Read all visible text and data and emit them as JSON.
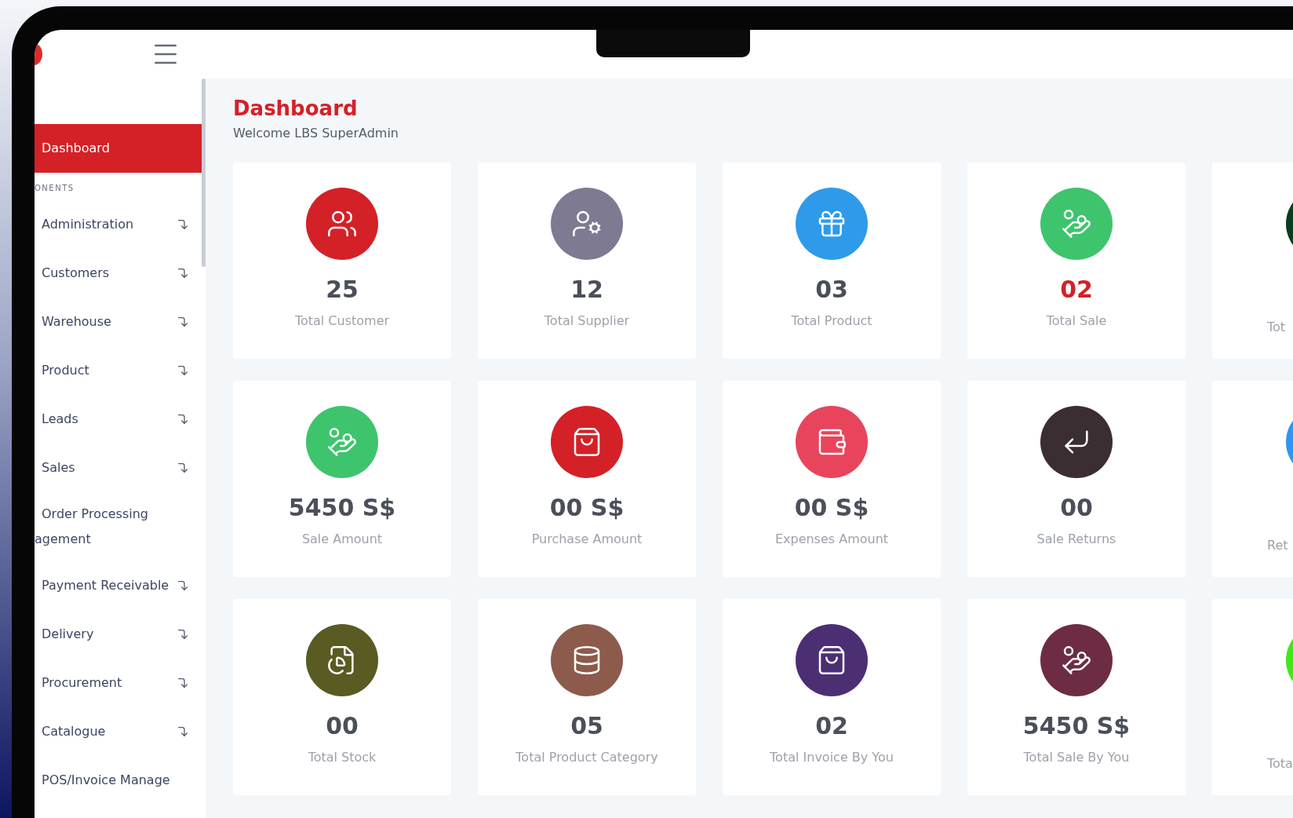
{
  "sidebar": {
    "items": [
      {
        "label": "Dashboard",
        "kind": "plain",
        "selected": true
      },
      {
        "label": "ONENTS",
        "kind": "heading"
      },
      {
        "label": "Administration",
        "kind": "expandable",
        "selected": false
      },
      {
        "label": "Customers",
        "kind": "expandable",
        "selected": false
      },
      {
        "label": "Warehouse",
        "kind": "expandable",
        "selected": false
      },
      {
        "label": "Product",
        "kind": "expandable",
        "selected": false
      },
      {
        "label": "Leads",
        "kind": "expandable",
        "selected": false
      },
      {
        "label": "Sales",
        "kind": "expandable",
        "selected": false
      },
      {
        "label": "Order Processing",
        "continued": "agement",
        "kind": "plain",
        "selected": false
      },
      {
        "label": "Payment Receivable",
        "kind": "expandable",
        "selected": false
      },
      {
        "label": "Delivery",
        "kind": "expandable",
        "selected": false
      },
      {
        "label": "Procurement",
        "kind": "expandable",
        "selected": false
      },
      {
        "label": "Catalogue",
        "kind": "expandable",
        "selected": false
      },
      {
        "label": "POS/Invoice Manage",
        "kind": "plain",
        "selected": false
      }
    ]
  },
  "header": {
    "title": "Dashboard",
    "subtitle": "Welcome LBS SuperAdmin"
  },
  "cards": [
    {
      "kind": "full",
      "value": "25",
      "label": "Total Customer",
      "color": "#d42127",
      "emphasis": false
    },
    {
      "kind": "full",
      "value": "12",
      "label": "Total Supplier",
      "color": "#7e7a92",
      "emphasis": false
    },
    {
      "kind": "full",
      "value": "03",
      "label": "Total Product",
      "color": "#2e9bea",
      "emphasis": false
    },
    {
      "kind": "full",
      "value": "02",
      "label": "Total Sale",
      "color": "#3ec46d",
      "emphasis": true
    },
    {
      "kind": "partial",
      "label": "Tot",
      "color": "#0a3d1e"
    },
    {
      "kind": "full",
      "value": "5450 S$",
      "label": "Sale Amount",
      "color": "#3ec46d",
      "emphasis": false
    },
    {
      "kind": "full",
      "value": "00 S$",
      "label": "Purchase Amount",
      "color": "#d42127",
      "emphasis": false
    },
    {
      "kind": "full",
      "value": "00 S$",
      "label": "Expenses Amount",
      "color": "#e8455d",
      "emphasis": false
    },
    {
      "kind": "full",
      "value": "00",
      "label": "Sale Returns",
      "color": "#3a2e33",
      "emphasis": false
    },
    {
      "kind": "partial",
      "label": "Ret",
      "color": "#2f96ef"
    },
    {
      "kind": "full",
      "value": "00",
      "label": "Total Stock",
      "color": "#5a5a23",
      "emphasis": false
    },
    {
      "kind": "full",
      "value": "05",
      "label": "Total Product Category",
      "color": "#8c5b4b",
      "emphasis": false
    },
    {
      "kind": "full",
      "value": "02",
      "label": "Total Invoice By You",
      "color": "#4c2f73",
      "emphasis": false
    },
    {
      "kind": "full",
      "value": "5450 S$",
      "label": "Total Sale By You",
      "color": "#6d2c44",
      "emphasis": false
    },
    {
      "kind": "partial",
      "label": "Tota",
      "color": "#44e61a"
    }
  ]
}
